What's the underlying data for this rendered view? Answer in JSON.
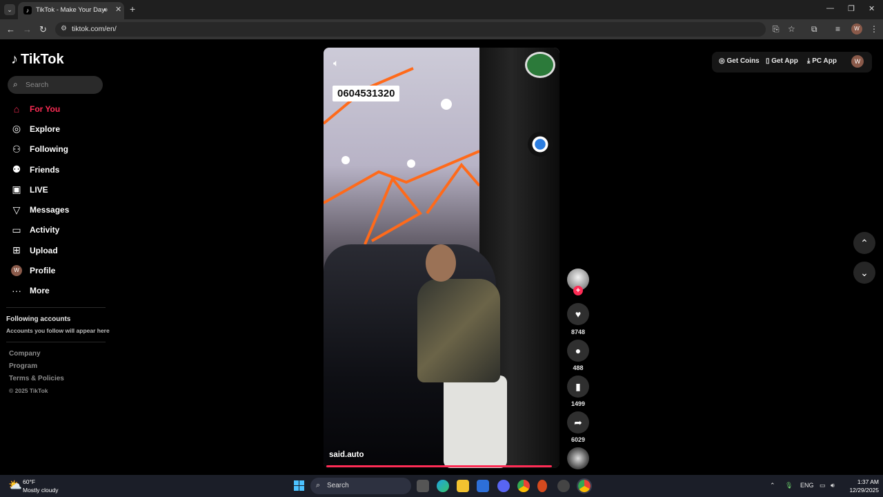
{
  "browser": {
    "tab_title": "TikTok - Make Your Day",
    "url": "tiktok.com/en/",
    "profile_initial": "W"
  },
  "sidebar": {
    "logo": "TikTok",
    "search_placeholder": "Search",
    "items": [
      {
        "label": "For You",
        "icon": "home-icon",
        "active": true
      },
      {
        "label": "Explore",
        "icon": "compass-icon"
      },
      {
        "label": "Following",
        "icon": "following-icon"
      },
      {
        "label": "Friends",
        "icon": "friends-icon"
      },
      {
        "label": "LIVE",
        "icon": "live-icon"
      },
      {
        "label": "Messages",
        "icon": "messages-icon"
      },
      {
        "label": "Activity",
        "icon": "activity-icon"
      },
      {
        "label": "Upload",
        "icon": "upload-icon"
      },
      {
        "label": "Profile",
        "icon": "avatar"
      },
      {
        "label": "More",
        "icon": "more-icon"
      }
    ],
    "profile_initial": "W",
    "following_title": "Following accounts",
    "following_sub": "Accounts you follow will appear here",
    "footer": [
      "Company",
      "Program",
      "Terms & Policies"
    ],
    "copyright": "© 2025 TikTok"
  },
  "video": {
    "caption_text": "0604531320",
    "username": "said.auto",
    "progress_percent": 98
  },
  "actions": {
    "likes": "8748",
    "comments": "488",
    "saves": "1499",
    "shares": "6029"
  },
  "header": {
    "get_coins": "Get Coins",
    "get_app": "Get App",
    "pc_app": "PC App",
    "avatar_initial": "W"
  },
  "taskbar": {
    "temp": "60°F",
    "weather": "Mostly cloudy",
    "search": "Search",
    "lang": "ENG",
    "time": "1:37 AM",
    "date": "12/29/2025"
  },
  "colors": {
    "accent": "#fe2c55",
    "bg": "#000000"
  }
}
